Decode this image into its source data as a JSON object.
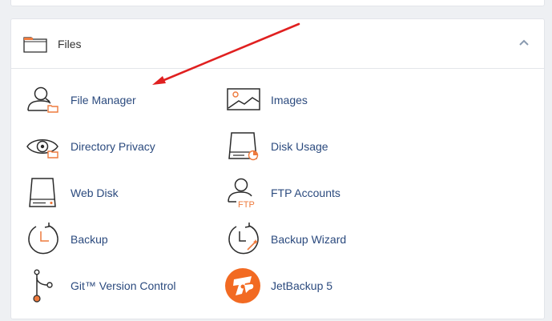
{
  "section": {
    "title": "Files",
    "items": [
      {
        "label": "File Manager",
        "icon": "file-manager-icon"
      },
      {
        "label": "Images",
        "icon": "images-icon"
      },
      {
        "label": "Directory Privacy",
        "icon": "directory-privacy-icon"
      },
      {
        "label": "Disk Usage",
        "icon": "disk-usage-icon"
      },
      {
        "label": "Web Disk",
        "icon": "web-disk-icon"
      },
      {
        "label": "FTP Accounts",
        "icon": "ftp-accounts-icon"
      },
      {
        "label": "Backup",
        "icon": "backup-icon"
      },
      {
        "label": "Backup Wizard",
        "icon": "backup-wizard-icon"
      },
      {
        "label": "Git™ Version Control",
        "icon": "git-icon"
      },
      {
        "label": "JetBackup 5",
        "icon": "jetbackup-icon"
      }
    ],
    "ftp_badge": "FTP",
    "jetbackup_glyph": "JB"
  },
  "colors": {
    "link": "#2b4a7e",
    "accent": "#ee7a3d",
    "arrow": "#e02020",
    "icon_stroke": "#2b2b2b"
  }
}
